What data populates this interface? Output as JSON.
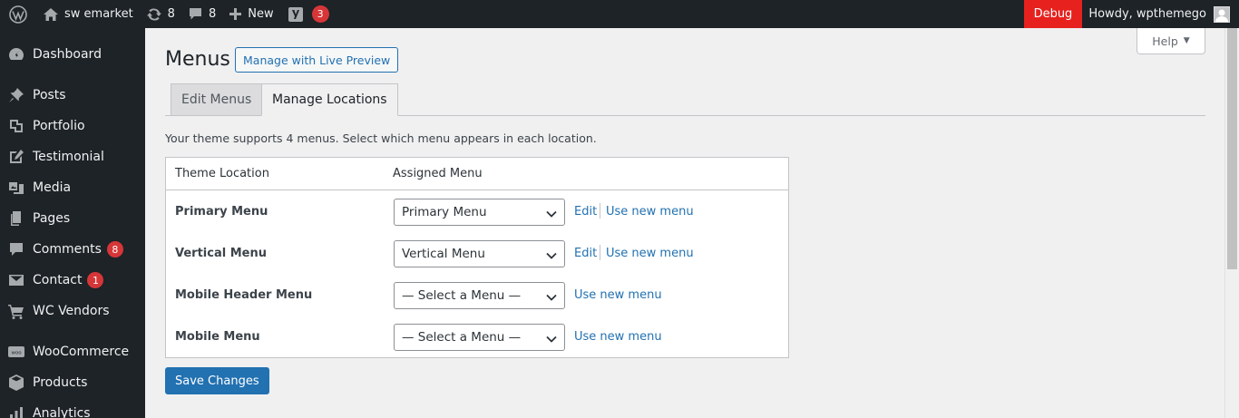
{
  "adminbar": {
    "site_name": "sw emarket",
    "updates_count": "8",
    "comments_count": "8",
    "new_label": "New",
    "yoast_count": "3",
    "debug_label": "Debug",
    "howdy": "Howdy, wpthemego",
    "icons": [
      "wordpress-logo-icon",
      "home-icon",
      "updates-icon",
      "comments-icon",
      "plus-icon",
      "yoast-icon",
      "avatar"
    ]
  },
  "sidebar": {
    "items": [
      {
        "label": "Dashboard",
        "icon": "dashboard-icon"
      },
      {
        "label": "Posts",
        "icon": "pin-icon"
      },
      {
        "label": "Portfolio",
        "icon": "portfolio-icon"
      },
      {
        "label": "Testimonial",
        "icon": "edit-icon"
      },
      {
        "label": "Media",
        "icon": "media-icon"
      },
      {
        "label": "Pages",
        "icon": "pages-icon"
      },
      {
        "label": "Comments",
        "icon": "comments-icon",
        "badge": "8"
      },
      {
        "label": "Contact",
        "icon": "mail-icon",
        "badge": "1"
      },
      {
        "label": "WC Vendors",
        "icon": "cart-icon"
      },
      {
        "label": "WooCommerce",
        "icon": "woo-icon"
      },
      {
        "label": "Products",
        "icon": "products-icon"
      },
      {
        "label": "Analytics",
        "icon": "analytics-icon"
      }
    ]
  },
  "main": {
    "title": "Menus",
    "live_preview_label": "Manage with Live Preview",
    "help_label": "Help",
    "tabs": [
      {
        "label": "Edit Menus",
        "active": false
      },
      {
        "label": "Manage Locations",
        "active": true
      }
    ],
    "intro": "Your theme supports 4 menus. Select which menu appears in each location.",
    "table": {
      "headers": [
        "Theme Location",
        "Assigned Menu"
      ],
      "rows": [
        {
          "location": "Primary Menu",
          "selected": "Primary Menu",
          "edit": "Edit",
          "use_new": "Use new menu"
        },
        {
          "location": "Vertical Menu",
          "selected": "Vertical Menu",
          "edit": "Edit",
          "use_new": "Use new menu"
        },
        {
          "location": "Mobile Header Menu",
          "selected": "— Select a Menu —",
          "use_new": "Use new menu"
        },
        {
          "location": "Mobile Menu",
          "selected": "— Select a Menu —",
          "use_new": "Use new menu"
        }
      ]
    },
    "save_label": "Save Changes"
  },
  "colors": {
    "adminbar_bg": "#1d2327",
    "debug_bg": "#e6211e",
    "badge": "#d63638",
    "link": "#2271b1",
    "primary_button": "#2271b1"
  }
}
